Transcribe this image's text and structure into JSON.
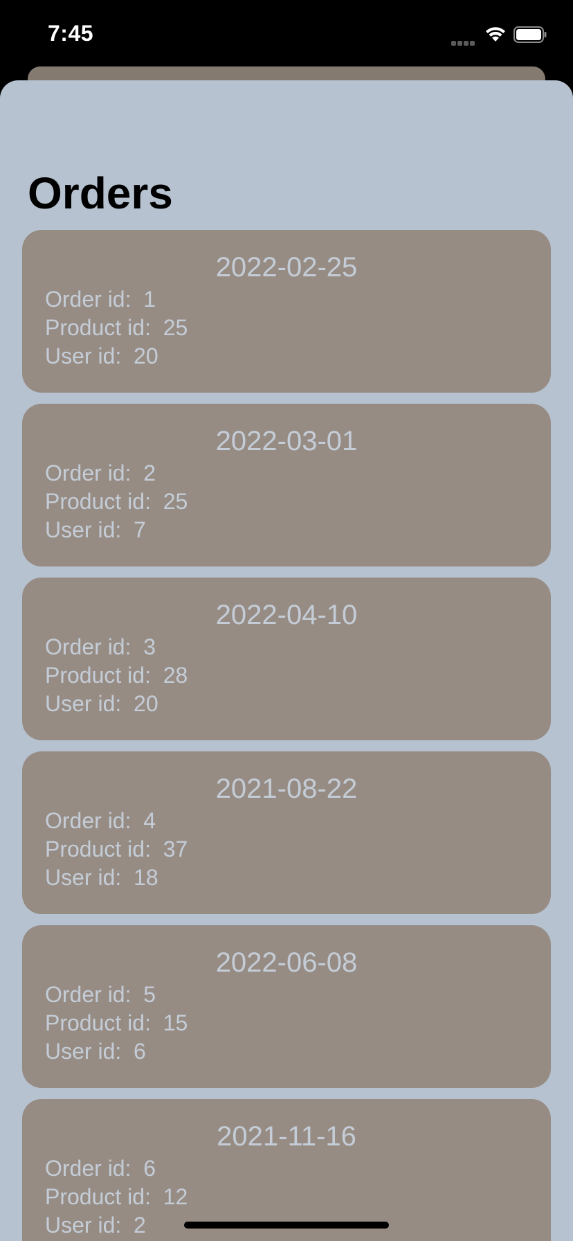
{
  "status_bar": {
    "time": "7:45"
  },
  "page": {
    "title": "Orders"
  },
  "labels": {
    "order_id": "Order id:",
    "product_id": "Product id:",
    "user_id": "User id:"
  },
  "orders": [
    {
      "date": "2022-02-25",
      "order_id": "1",
      "product_id": "25",
      "user_id": "20"
    },
    {
      "date": "2022-03-01",
      "order_id": "2",
      "product_id": "25",
      "user_id": "7"
    },
    {
      "date": "2022-04-10",
      "order_id": "3",
      "product_id": "28",
      "user_id": "20"
    },
    {
      "date": "2021-08-22",
      "order_id": "4",
      "product_id": "37",
      "user_id": "18"
    },
    {
      "date": "2022-06-08",
      "order_id": "5",
      "product_id": "15",
      "user_id": "6"
    },
    {
      "date": "2021-11-16",
      "order_id": "6",
      "product_id": "12",
      "user_id": "2"
    }
  ],
  "icons": {
    "signal": "cellular-signal-icon",
    "wifi": "wifi-icon",
    "battery": "battery-icon"
  },
  "colors": {
    "sheet_background": "#b6c2cf",
    "card_background": "#978c84",
    "card_text": "#c4cdd7",
    "title_text": "#000000"
  }
}
